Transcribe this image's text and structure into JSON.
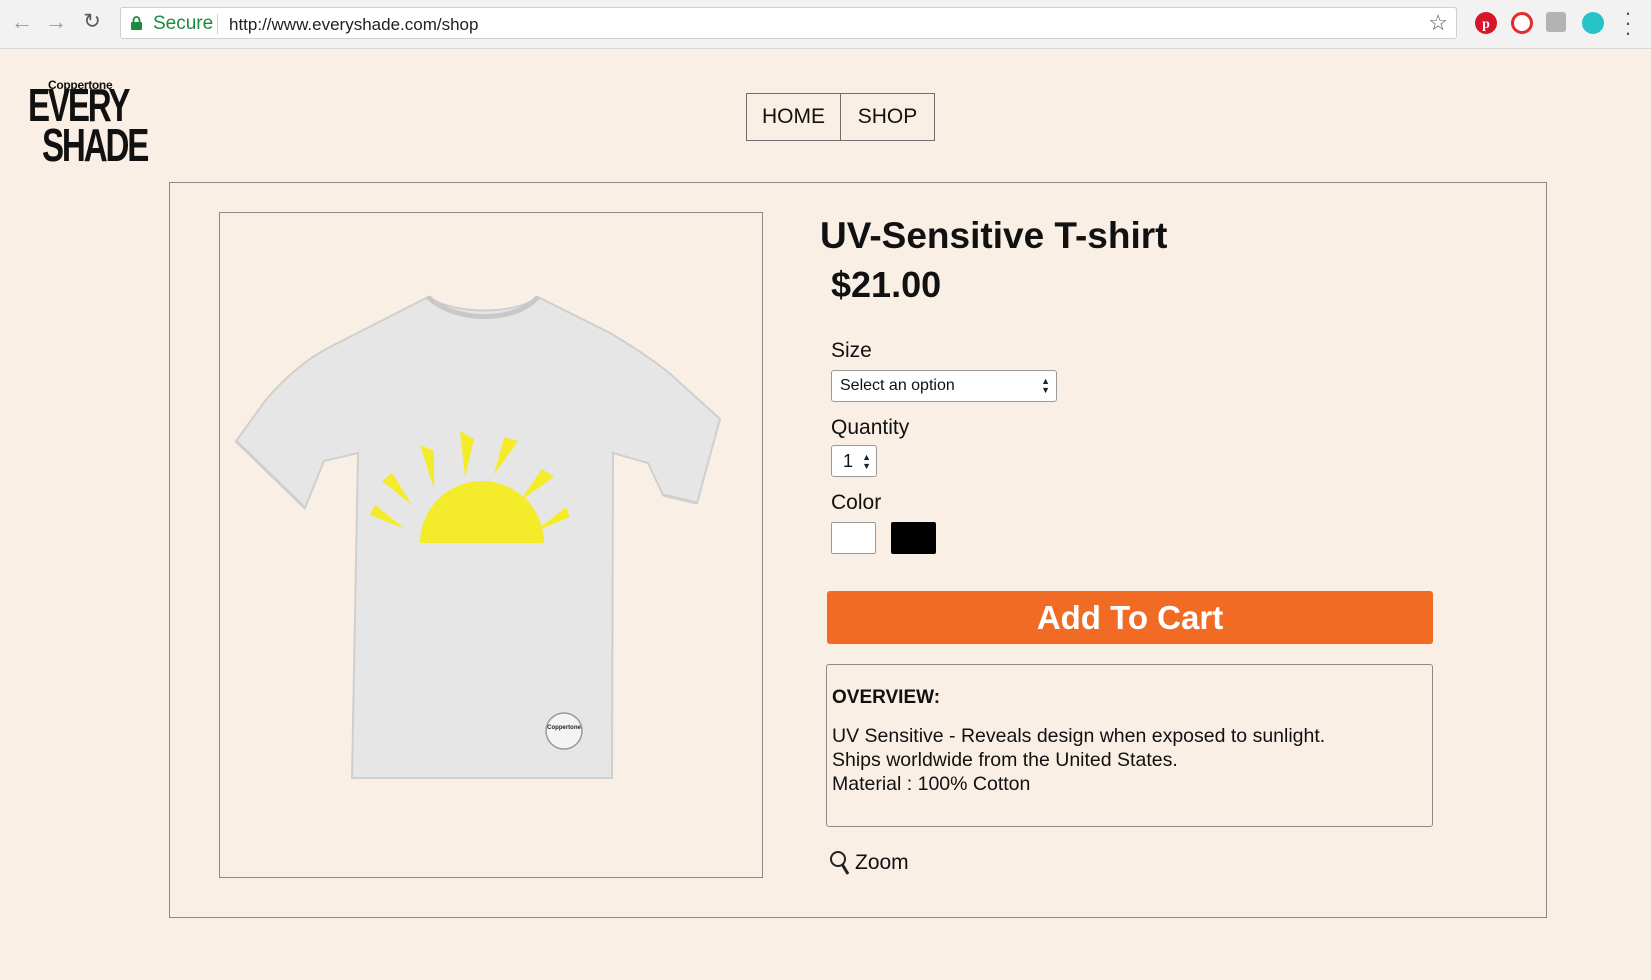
{
  "browser": {
    "secure_label": "Secure",
    "url": "http://www.everyshade.com/shop"
  },
  "logo": {
    "brand": "Coppertone",
    "line1": "EVERY",
    "line2": "SHADE"
  },
  "nav": {
    "home": "HOME",
    "shop": "SHOP"
  },
  "product": {
    "title": "UV-Sensitive T-shirt",
    "price": "$21.00",
    "shirt_print_text": "Coppertone",
    "size_label": "Size",
    "size_selected": "Select an option",
    "quantity_label": "Quantity",
    "quantity_value": "1",
    "color_label": "Color",
    "colors": [
      {
        "name": "white",
        "hex": "#ffffff"
      },
      {
        "name": "black",
        "hex": "#000000"
      }
    ],
    "add_to_cart": "Add To Cart",
    "overview": {
      "heading": "OVERVIEW:",
      "lines": [
        "UV Sensitive - Reveals design when exposed to sunlight.",
        "Ships worldwide from the United States.",
        "Material : 100% Cotton"
      ]
    },
    "zoom_label": "Zoom"
  },
  "colors": {
    "page_bg": "#faefe5",
    "cta": "#f16b25",
    "secure_green": "#1e8a3e"
  }
}
